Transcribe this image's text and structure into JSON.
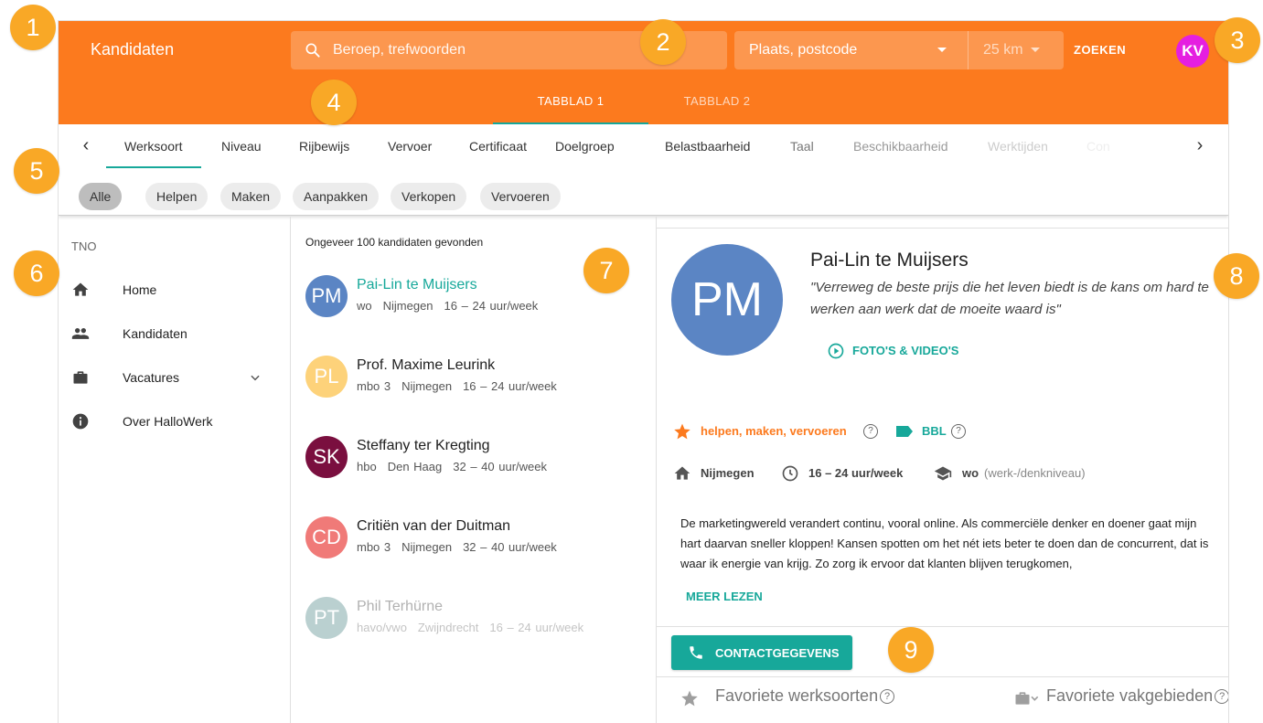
{
  "header": {
    "title": "Kandidaten",
    "search_placeholder": "Beroep, trefwoorden",
    "place_placeholder": "Plaats, postcode",
    "distance": "25 km",
    "search_button": "ZOEKEN",
    "user_initials": "KV",
    "user_color": "#e51fe0",
    "brand_color": "#fc7a1e",
    "accent_color": "#17a89a",
    "tabs": [
      {
        "label": "TABBLAD 1",
        "active": true
      },
      {
        "label": "TABBLAD 2",
        "active": false
      }
    ]
  },
  "filter_tabs": [
    "Werksoort",
    "Niveau",
    "Rijbewijs",
    "Vervoer",
    "Certificaat",
    "Doelgroep",
    "Belastbaarheid",
    "Taal",
    "Beschikbaarheid",
    "Werktijden",
    "Con"
  ],
  "chips": [
    "Alle",
    "Helpen",
    "Maken",
    "Aanpakken",
    "Verkopen",
    "Vervoeren"
  ],
  "sidebar": {
    "org": "TNO",
    "items": [
      {
        "label": "Home",
        "icon": "home-icon"
      },
      {
        "label": "Kandidaten",
        "icon": "people-icon"
      },
      {
        "label": "Vacatures",
        "icon": "briefcase-icon",
        "expandable": true
      },
      {
        "label": "Over HalloWerk",
        "icon": "info-icon"
      }
    ]
  },
  "list": {
    "count_text": "Ongeveer 100 kandidaten gevonden",
    "candidates": [
      {
        "initials": "PM",
        "name": "Pai-Lin te Muijsers",
        "level": "wo",
        "city": "Nijmegen",
        "hours": "16 – 24 uur/week",
        "color": "#5b85c4",
        "selected": true
      },
      {
        "initials": "PL",
        "name": "Prof. Maxime Leurink",
        "level": "mbo 3",
        "city": "Nijmegen",
        "hours": "16 – 24 uur/week",
        "color": "#fdd27a"
      },
      {
        "initials": "SK",
        "name": "Steffany ter Kregting",
        "level": "hbo",
        "city": "Den Haag",
        "hours": "32 – 40 uur/week",
        "color": "#7a0f3f"
      },
      {
        "initials": "CD",
        "name": "Critiën van der Duitman",
        "level": "mbo 3",
        "city": "Nijmegen",
        "hours": "32 – 40 uur/week",
        "color": "#f07a78"
      },
      {
        "initials": "PT",
        "name": "Phil Terhürne",
        "level": "havo/vwo",
        "city": "Zwijndrecht",
        "hours": "16 – 24 uur/week",
        "color": "#3d7a7a"
      }
    ]
  },
  "detail": {
    "initials": "PM",
    "name": "Pai-Lin te Muijsers",
    "quote": "\"Verreweg de beste prijs die het leven biedt is de kans om hard te werken aan werk dat de moeite waard is\"",
    "media_label": "FOTO'S & VIDEO'S",
    "work_types": "helpen, maken, vervoeren",
    "tag": "BBL",
    "city": "Nijmegen",
    "hours": "16 – 24 uur/week",
    "level": "wo",
    "level_note": "(werk-/denkniveau)",
    "description": "De marketingwereld verandert continu, vooral online. Als commerciële denker en doener gaat mijn hart daarvan sneller kloppen! Kansen spotten om het nét iets beter te doen dan de concurrent, dat is waar ik energie van krijg. Zo zorg ik ervoor dat klanten blijven terugkomen,",
    "more_label": "MEER LEZEN",
    "contact_label": "CONTACTGEGEVENS",
    "fav_worktypes": "Favoriete werksoorten",
    "fav_fields": "Favoriete vakgebieden",
    "help_mark": "?"
  },
  "badges": [
    "1",
    "2",
    "3",
    "4",
    "5",
    "6",
    "7",
    "8",
    "9"
  ]
}
